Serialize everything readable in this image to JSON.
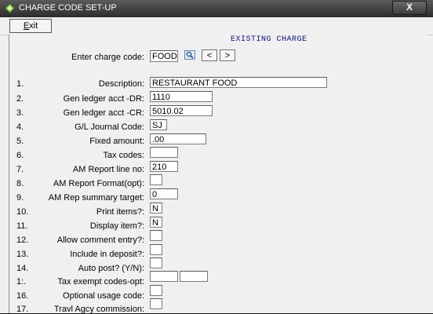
{
  "window": {
    "title": "CHARGE CODE SET-UP",
    "close_glyph": "X"
  },
  "toolbar": {
    "exit_label_u": "E",
    "exit_label_rest": "xit"
  },
  "banner": "EXISTING CHARGE",
  "charge_code": {
    "label": "Enter charge code:",
    "value": "FOOD",
    "prev_label": "<",
    "next_label": ">"
  },
  "rows": [
    {
      "num": "1.",
      "label": "Description:",
      "value": "RESTAURANT FOOD"
    },
    {
      "num": "2.",
      "label": "Gen ledger acct -DR:",
      "value": "1110"
    },
    {
      "num": "3.",
      "label": "Gen ledger acct -CR:",
      "value": "5010.02"
    },
    {
      "num": "4.",
      "label": "G/L Journal Code:",
      "value": "SJ"
    },
    {
      "num": "5.",
      "label": "Fixed amount:",
      "value": ".00"
    },
    {
      "num": "6.",
      "label": "Tax codes:",
      "value": ""
    },
    {
      "num": "7.",
      "label": "AM Report line no:",
      "value": "210"
    },
    {
      "num": "8.",
      "label": "AM Report Format(opt):",
      "value": ""
    },
    {
      "num": "9.",
      "label": "AM Rep summary target:",
      "value": "0"
    },
    {
      "num": "10.",
      "label": "Print items?:",
      "value": "N"
    },
    {
      "num": "11.",
      "label": "Display item?:",
      "value": "N"
    },
    {
      "num": "12.",
      "label": "Allow comment entry?:",
      "value": ""
    },
    {
      "num": "13.",
      "label": "Include in deposit?:",
      "value": ""
    },
    {
      "num": "14.",
      "label": "Auto post? (Y/N):",
      "value": ""
    },
    {
      "num": "1:.",
      "label": "Tax exempt codes-opt:",
      "value": "",
      "value2": ""
    },
    {
      "num": "16.",
      "label": "Optional usage code:",
      "value": ""
    },
    {
      "num": "17.",
      "label": "Travl Agcy commission:",
      "value": ""
    }
  ]
}
